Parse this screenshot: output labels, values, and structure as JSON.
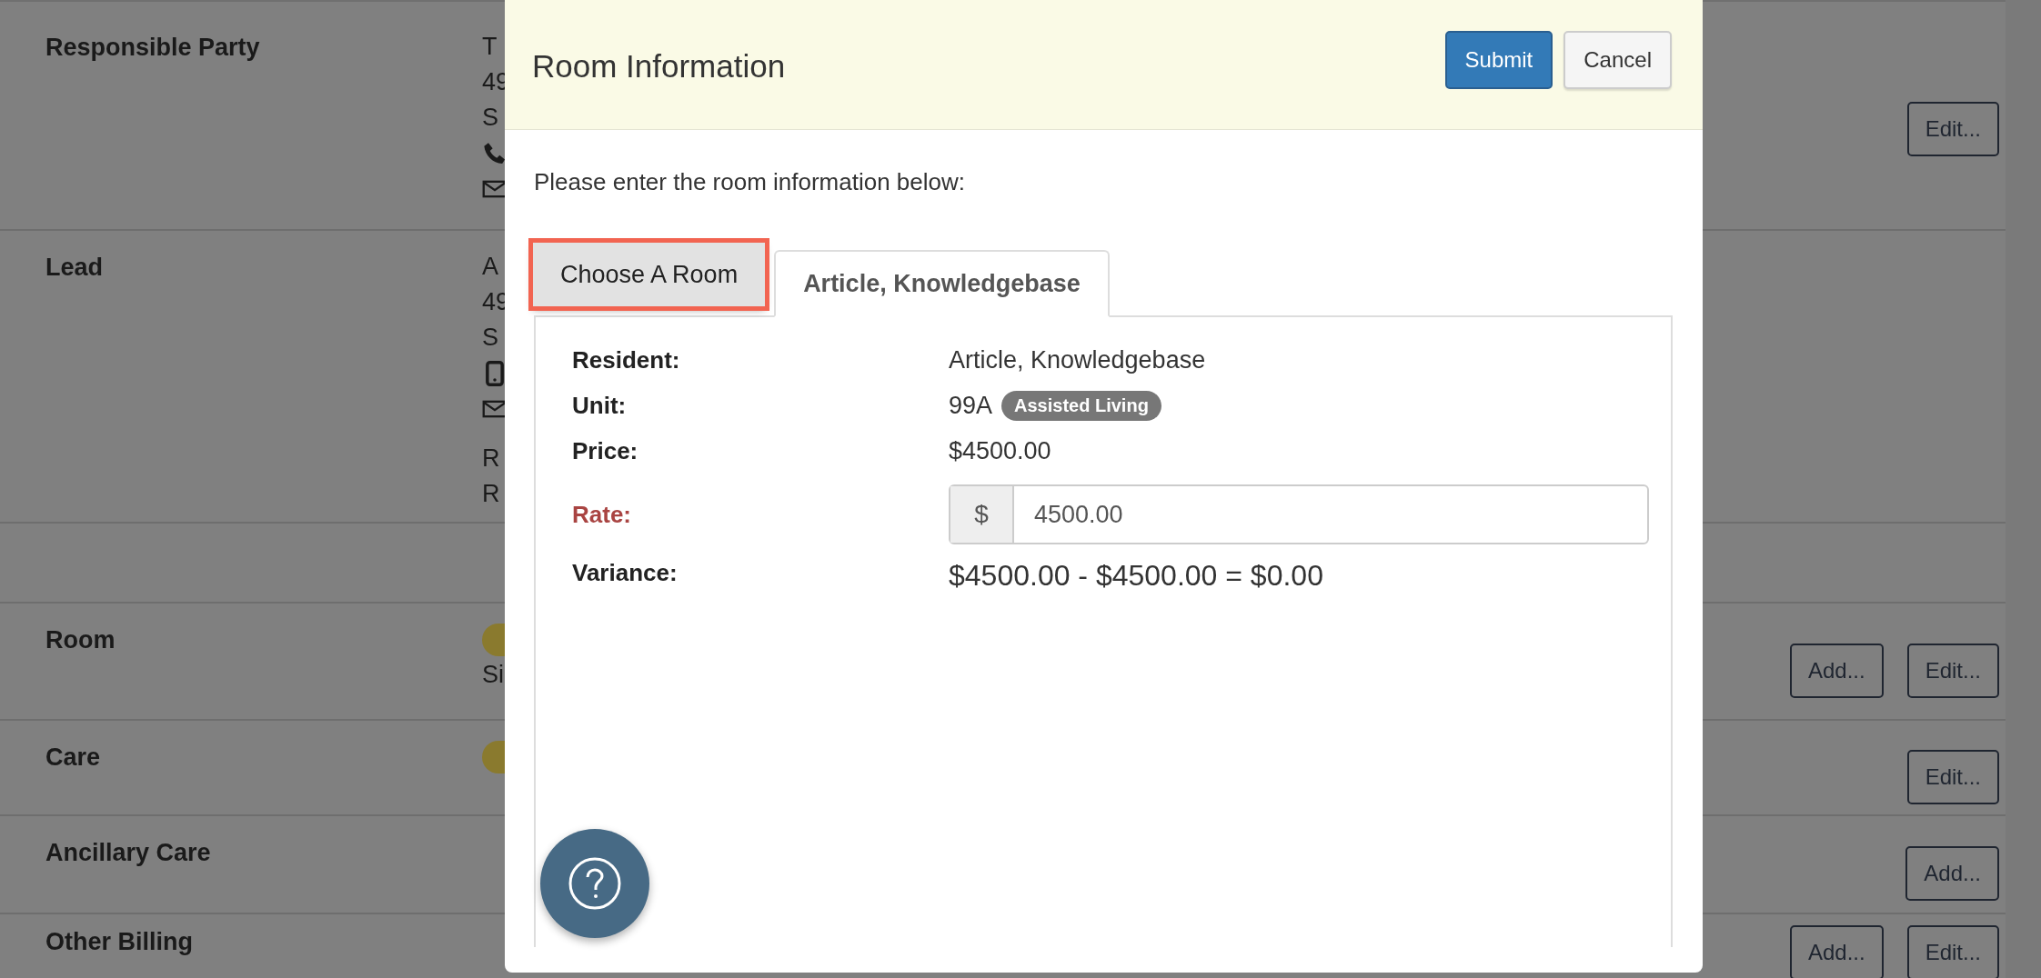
{
  "background": {
    "sections": [
      {
        "label": "Responsible Party",
        "lines": [
          {
            "kind": "text",
            "text": "T"
          },
          {
            "kind": "text",
            "text": "49"
          },
          {
            "kind": "text",
            "text": "S"
          },
          {
            "kind": "phone"
          },
          {
            "kind": "mail"
          }
        ],
        "buttons": [
          "Edit..."
        ]
      },
      {
        "label": "Lead",
        "lines": [
          {
            "kind": "text",
            "text": "A"
          },
          {
            "kind": "text",
            "text": "49"
          },
          {
            "kind": "text",
            "text": "S"
          },
          {
            "kind": "mobile"
          },
          {
            "kind": "mail"
          },
          {
            "kind": "gap"
          },
          {
            "kind": "text",
            "text": "R"
          },
          {
            "kind": "text",
            "text": "R"
          }
        ]
      },
      {
        "kind": "spacer"
      },
      {
        "label": "Room",
        "lines": [
          {
            "kind": "badge"
          },
          {
            "kind": "text",
            "text": "Si"
          }
        ],
        "buttons": [
          "Add...",
          "Edit..."
        ]
      },
      {
        "label": "Care",
        "lines": [
          {
            "kind": "badge"
          }
        ],
        "buttons": [
          "Edit..."
        ]
      },
      {
        "label": "Ancillary Care",
        "buttons": [
          "Add..."
        ]
      },
      {
        "label": "Other Billing",
        "buttons": [
          "Add...",
          "Edit..."
        ]
      }
    ]
  },
  "modal": {
    "title": "Room Information",
    "buttons": [
      {
        "label": "Submit",
        "kind": "primary"
      },
      {
        "label": "Cancel",
        "kind": "default"
      }
    ],
    "intro": "Please enter the room information below:",
    "tabs": [
      {
        "label": "Choose A Room",
        "selected": false,
        "highlighted": true
      },
      {
        "label": "Article, Knowledgebase",
        "selected": true,
        "highlighted": false
      }
    ],
    "fields": [
      {
        "label": "Resident:",
        "kind": "text",
        "value": "Article, Knowledgebase",
        "error": false
      },
      {
        "label": "Unit:",
        "kind": "unit",
        "value": "99A",
        "tag": "Assisted Living",
        "error": false
      },
      {
        "label": "Price:",
        "kind": "text",
        "value": "$4500.00",
        "error": false
      },
      {
        "label": "Rate:",
        "kind": "input",
        "prefix": "$",
        "value": "4500.00",
        "error": true
      },
      {
        "label": "Variance:",
        "kind": "large",
        "value": "$4500.00 - $4500.00 = $0.00",
        "error": false
      }
    ]
  }
}
